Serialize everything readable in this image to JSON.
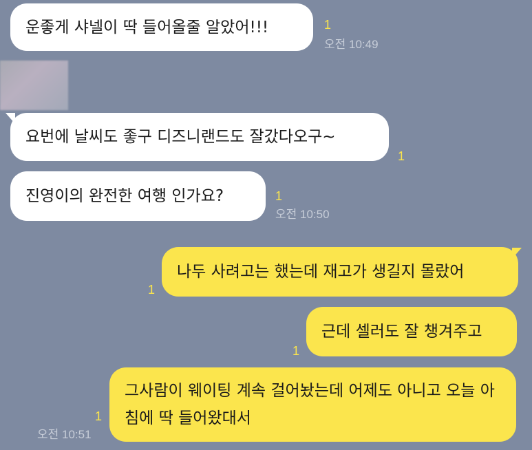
{
  "messages": [
    {
      "text": "운좋게 샤넬이 딱 들어올줄 알았어!!!",
      "unread": "1",
      "time": "오전 10:49"
    },
    {
      "text": "요번에 날씨도 좋구 디즈니랜드도 잘갔다오구~",
      "unread": "1"
    },
    {
      "text": "진영이의 완전한 여행 인가요?",
      "unread": "1",
      "time": "오전 10:50"
    },
    {
      "text": "나두 사려고는 했는데 재고가 생길지 몰랐어",
      "unread": "1"
    },
    {
      "text": "근데 셀러도 잘 챙겨주고",
      "unread": "1"
    },
    {
      "text": "그사람이 웨이팅 계속 걸어놨는데 어제도 아니고 오늘 아침에 딱 들어왔대서",
      "unread": "1",
      "time": "오전 10:51"
    }
  ],
  "colors": {
    "background": "#7e8aa1",
    "incoming_bubble": "#ffffff",
    "outgoing_bubble": "#fbe54d",
    "unread_count": "#fbe54d",
    "timestamp": "#c7cdd8"
  },
  "icons": {
    "avatar": "blurred-profile-avatar"
  }
}
